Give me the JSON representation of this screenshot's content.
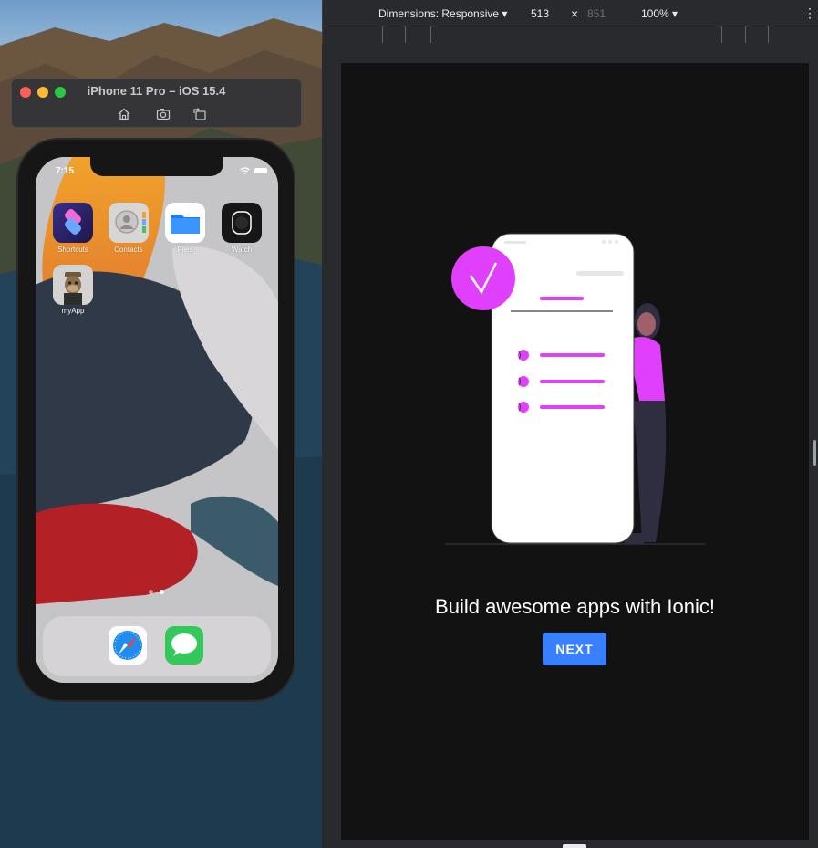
{
  "simulator": {
    "title": "iPhone 11 Pro – iOS 15.4",
    "buttons": {
      "home": "home-icon",
      "screenshot": "screenshot-icon",
      "rotate": "rotate-icon"
    }
  },
  "phone": {
    "status_time": "7:15",
    "apps": [
      {
        "label": "Shortcuts"
      },
      {
        "label": "Contacts"
      },
      {
        "label": "Files"
      },
      {
        "label": "Watch"
      },
      {
        "label": "myApp"
      }
    ],
    "dock_apps": [
      "Safari",
      "Messages"
    ],
    "page_dots": 2,
    "active_page": 2
  },
  "devtools": {
    "dimensions_label": "Dimensions: Responsive ▾",
    "width": "513",
    "times": "×",
    "height": "851",
    "zoom": "100% ▾",
    "more": "⋮"
  },
  "app_page": {
    "headline": "Build awesome apps with Ionic!",
    "next_label": "NEXT",
    "colors": {
      "accent": "#e040fb",
      "button": "#3880ff",
      "background": "#121212"
    }
  }
}
